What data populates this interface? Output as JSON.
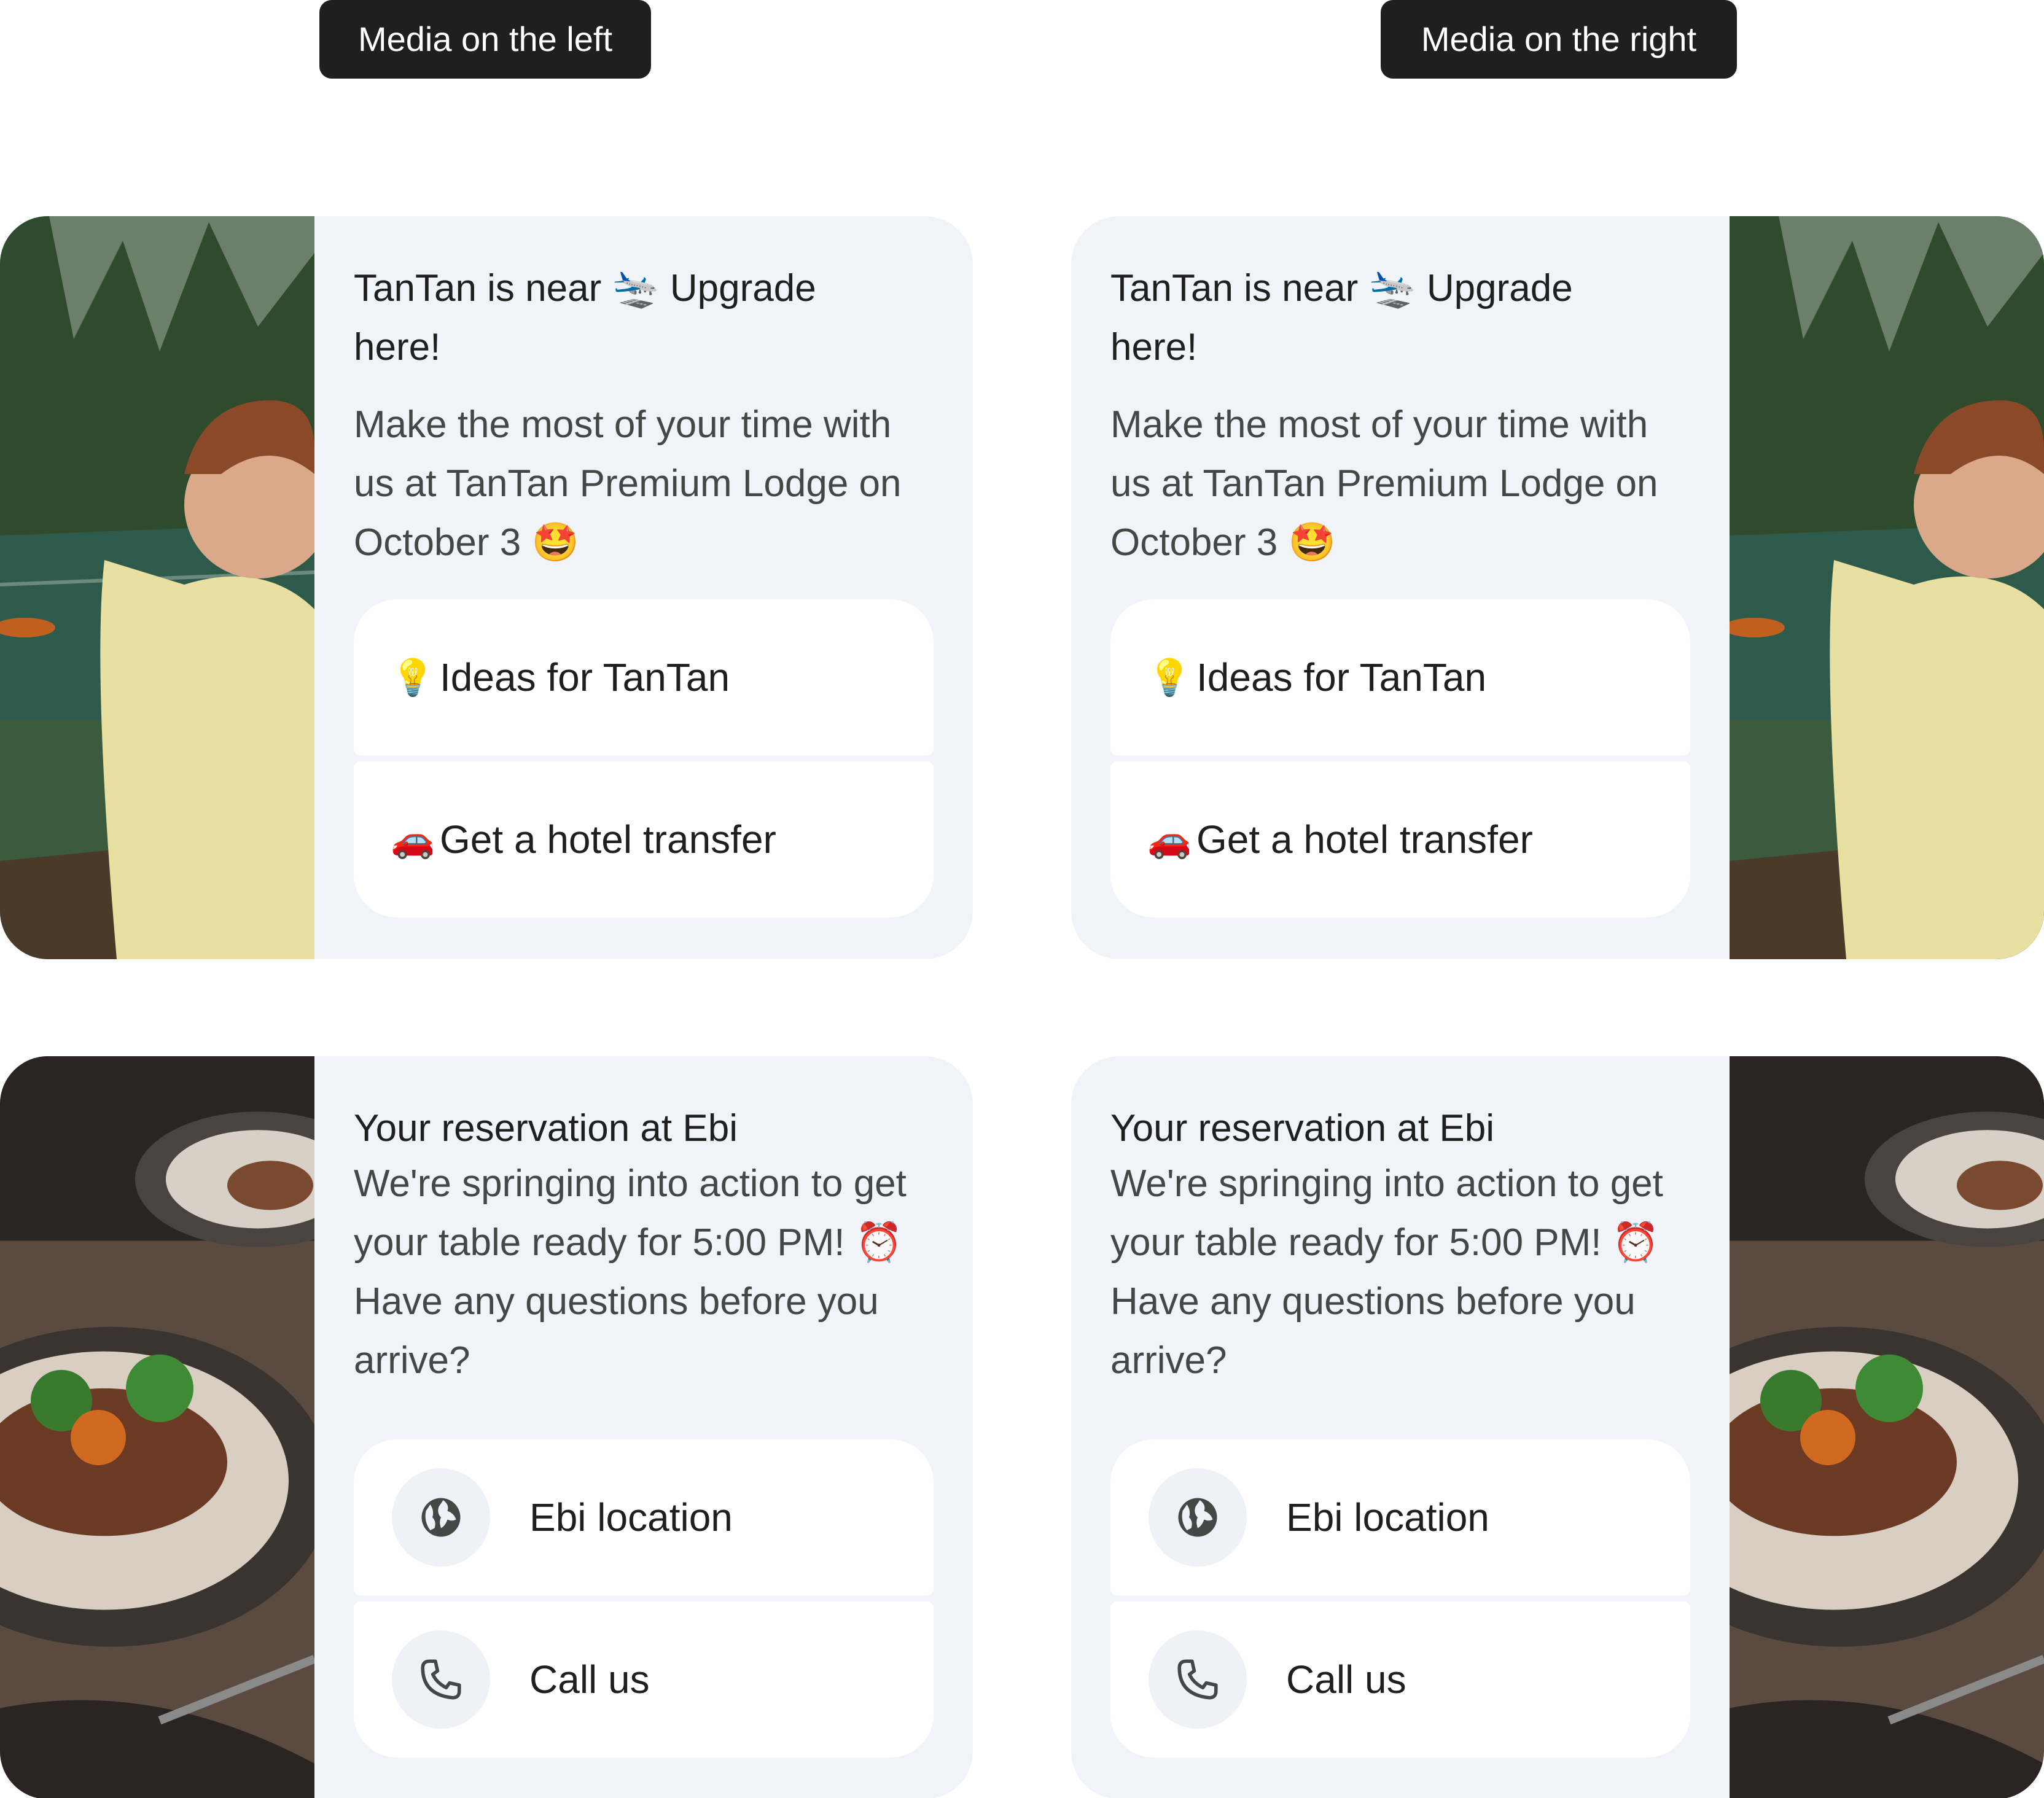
{
  "labels": {
    "left": "Media on the left",
    "right": "Media on the right"
  },
  "hotel_card": {
    "title": "TanTan is near 🛬 Upgrade here!",
    "body": "Make the most of your time with us at TanTan Premium Lodge on October 3 🤩",
    "chips": [
      {
        "emoji": "💡",
        "label": "Ideas for TanTan"
      },
      {
        "emoji": "🚗",
        "label": "Get a hotel transfer"
      }
    ]
  },
  "restaurant_card": {
    "title": "Your reservation at Ebi",
    "body": "We're springing into action to get your table ready for 5:00 PM! ⏰  Have any questions before you arrive?",
    "chips": [
      {
        "icon": "globe-icon",
        "label": "Ebi location"
      },
      {
        "icon": "phone-icon",
        "label": "Call us"
      }
    ]
  },
  "colors": {
    "card_bg": "#f0f4f9",
    "chip_bg": "#ffffff",
    "label_bg": "#1f1f1f",
    "title_text": "#1f1f1f",
    "body_text": "#444746"
  }
}
